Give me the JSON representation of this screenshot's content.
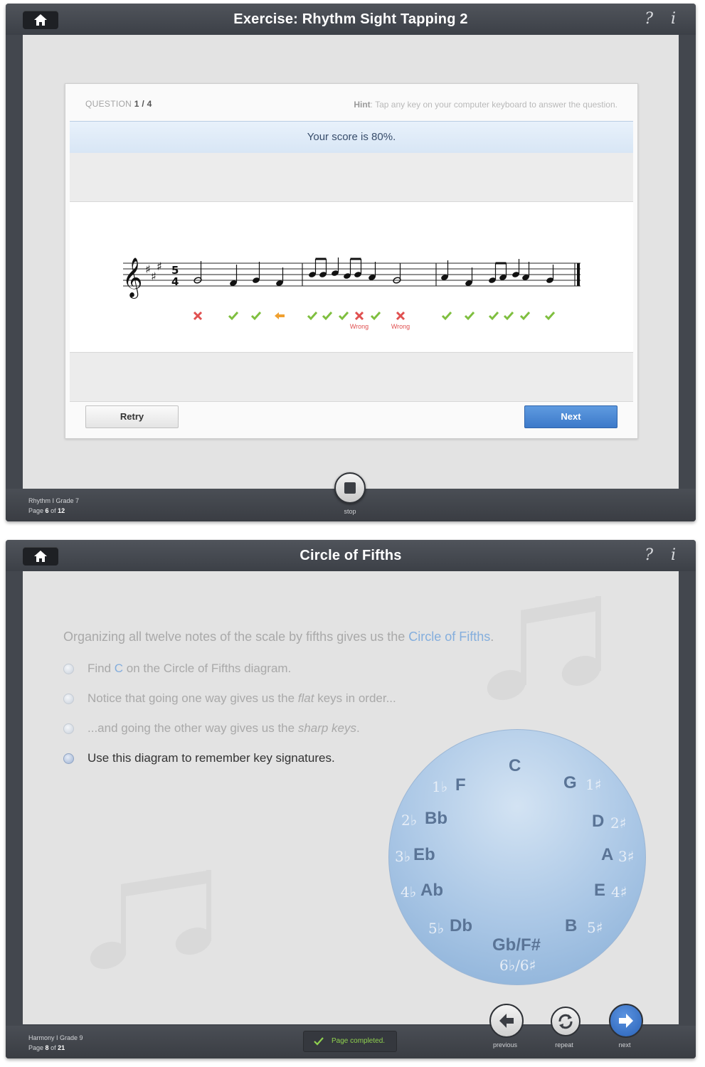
{
  "window1": {
    "title": "Exercise: Rhythm Sight Tapping 2",
    "question_label": "QUESTION",
    "question_num": "1 / 4",
    "hint_label": "Hint",
    "hint_text": ": Tap any key on your computer keyboard to answer the question.",
    "score_text": "Your score is 80%.",
    "marks": [
      "wrong",
      "correct",
      "correct",
      "early",
      "correct",
      "correct",
      "correct",
      "wrong",
      "correct",
      "wrong",
      "correct",
      "correct",
      "correct",
      "correct",
      "correct",
      "correct"
    ],
    "wrong_label": "Wrong",
    "retry_label": "Retry",
    "next_label": "Next",
    "stop_label": "stop",
    "breadcrumb": "Rhythm I Grade 7",
    "page_prefix": "Page",
    "page_current": "6",
    "page_of": "of",
    "page_total": "12"
  },
  "window2": {
    "title": "Circle of Fifths",
    "intro_before": "Organizing all twelve notes of the scale by fifths gives us the ",
    "intro_link": "Circle of Fifths",
    "intro_after": ".",
    "bullets": [
      {
        "parts": [
          "Find ",
          "C",
          " on the Circle of Fifths diagram."
        ]
      },
      {
        "parts": [
          "Notice that going one way gives us the ",
          "flat",
          " keys in order..."
        ]
      },
      {
        "parts": [
          "...and going the other way gives us the ",
          "sharp keys",
          "."
        ]
      },
      {
        "parts": [
          "Use this diagram to remember key signatures."
        ]
      }
    ],
    "circle": {
      "top": "C",
      "keys": [
        "F",
        "Bb",
        "Eb",
        "Ab",
        "Db",
        "Gb/F#",
        "G",
        "D",
        "A",
        "E",
        "B"
      ],
      "flats": [
        "1♭",
        "2♭",
        "3♭",
        "4♭",
        "5♭"
      ],
      "sharps": [
        "1♯",
        "2♯",
        "3♯",
        "4♯",
        "5♯"
      ],
      "bottom_acc": "6♭/6♯"
    },
    "completed_text": "Page completed.",
    "previous_label": "previous",
    "repeat_label": "repeat",
    "next_label": "next",
    "breadcrumb": "Harmony I Grade 9",
    "page_prefix": "Page",
    "page_current": "8",
    "page_of": "of",
    "page_total": "21"
  },
  "colors": {
    "primary_blue": "#3c79c9",
    "correct": "#7fbf3f",
    "wrong": "#e05050",
    "early": "#f0a030"
  },
  "icons": [
    "home-icon",
    "help-icon",
    "info-icon",
    "stop-icon",
    "check-icon",
    "cross-icon",
    "arrow-left-icon",
    "arrow-right-icon",
    "repeat-icon",
    "music-note-icon"
  ]
}
